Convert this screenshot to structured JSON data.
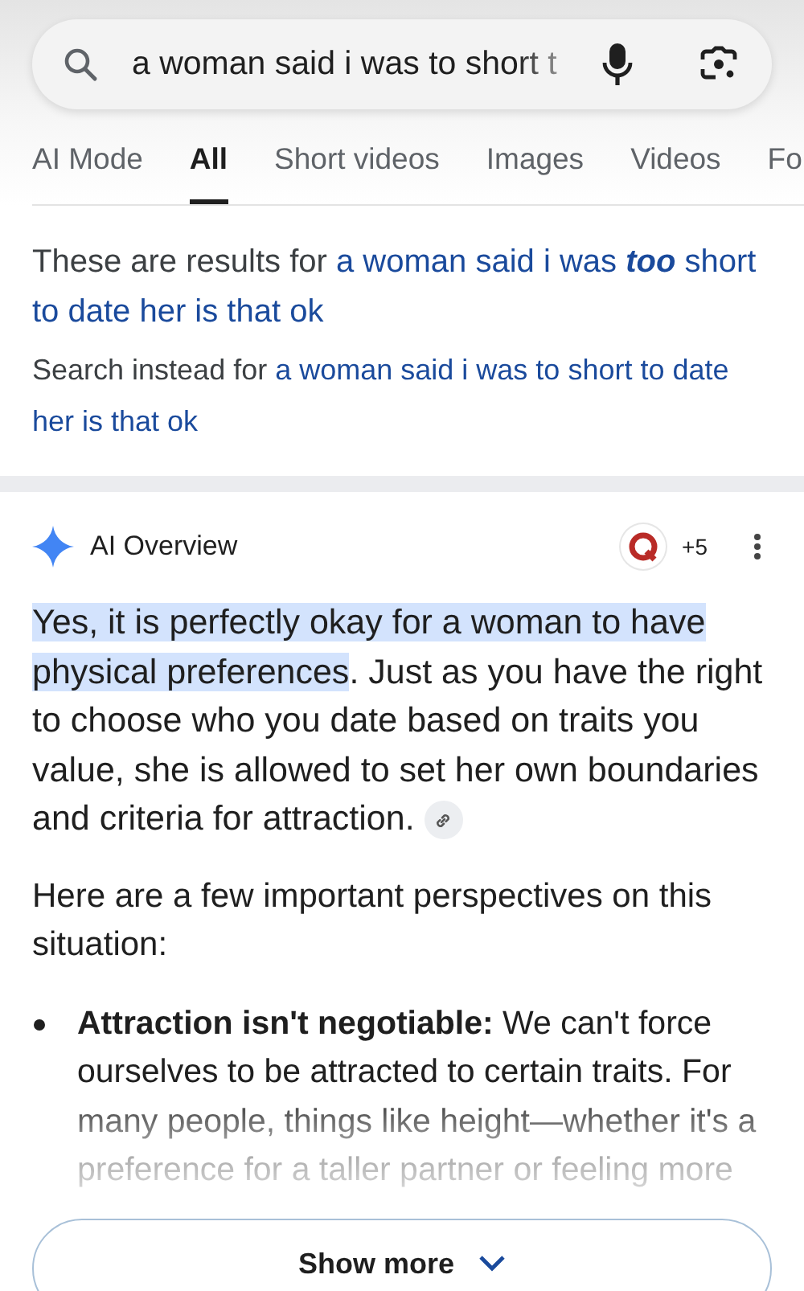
{
  "search": {
    "value": "a woman said i was to short t"
  },
  "tabs": [
    {
      "label": "AI Mode",
      "selected": false
    },
    {
      "label": "All",
      "selected": true
    },
    {
      "label": "Short videos",
      "selected": false
    },
    {
      "label": "Images",
      "selected": false
    },
    {
      "label": "Videos",
      "selected": false
    },
    {
      "label": "Fo",
      "selected": false
    }
  ],
  "correction": {
    "label": "These are results for",
    "query_lines": [
      {
        "parts": [
          {
            "text": "a woman said i was ",
            "emphasis": false
          },
          {
            "text": "too",
            "emphasis": true
          },
          {
            "text": " short",
            "emphasis": false
          }
        ]
      },
      {
        "parts": [
          {
            "text": "to date her is that ok",
            "emphasis": false
          }
        ]
      }
    ],
    "instead_label": "Search instead for",
    "instead_lines": [
      "a woman said i was to short to date",
      "her is that ok"
    ]
  },
  "ai_overview": {
    "title": "AI Overview",
    "sources_count": "+5",
    "intro_parts": [
      {
        "text": "Yes, it is perfectly okay for a woman to have physical preferences",
        "highlighted": true
      },
      {
        "text": ". Just as you have the right to choose who you date based on traits you value, she is allowed to set her own boundaries and criteria for attraction.",
        "highlighted": false
      }
    ],
    "lead": "Here are a few important perspectives on this situation:",
    "bullets": [
      {
        "text": "**Attraction isn't negotiable:** We can't force ourselves to be attracted to certain traits. For many people, things like height—whether it's a preference for a taller partner or feeling more"
      }
    ],
    "show_more": "Show more"
  }
}
